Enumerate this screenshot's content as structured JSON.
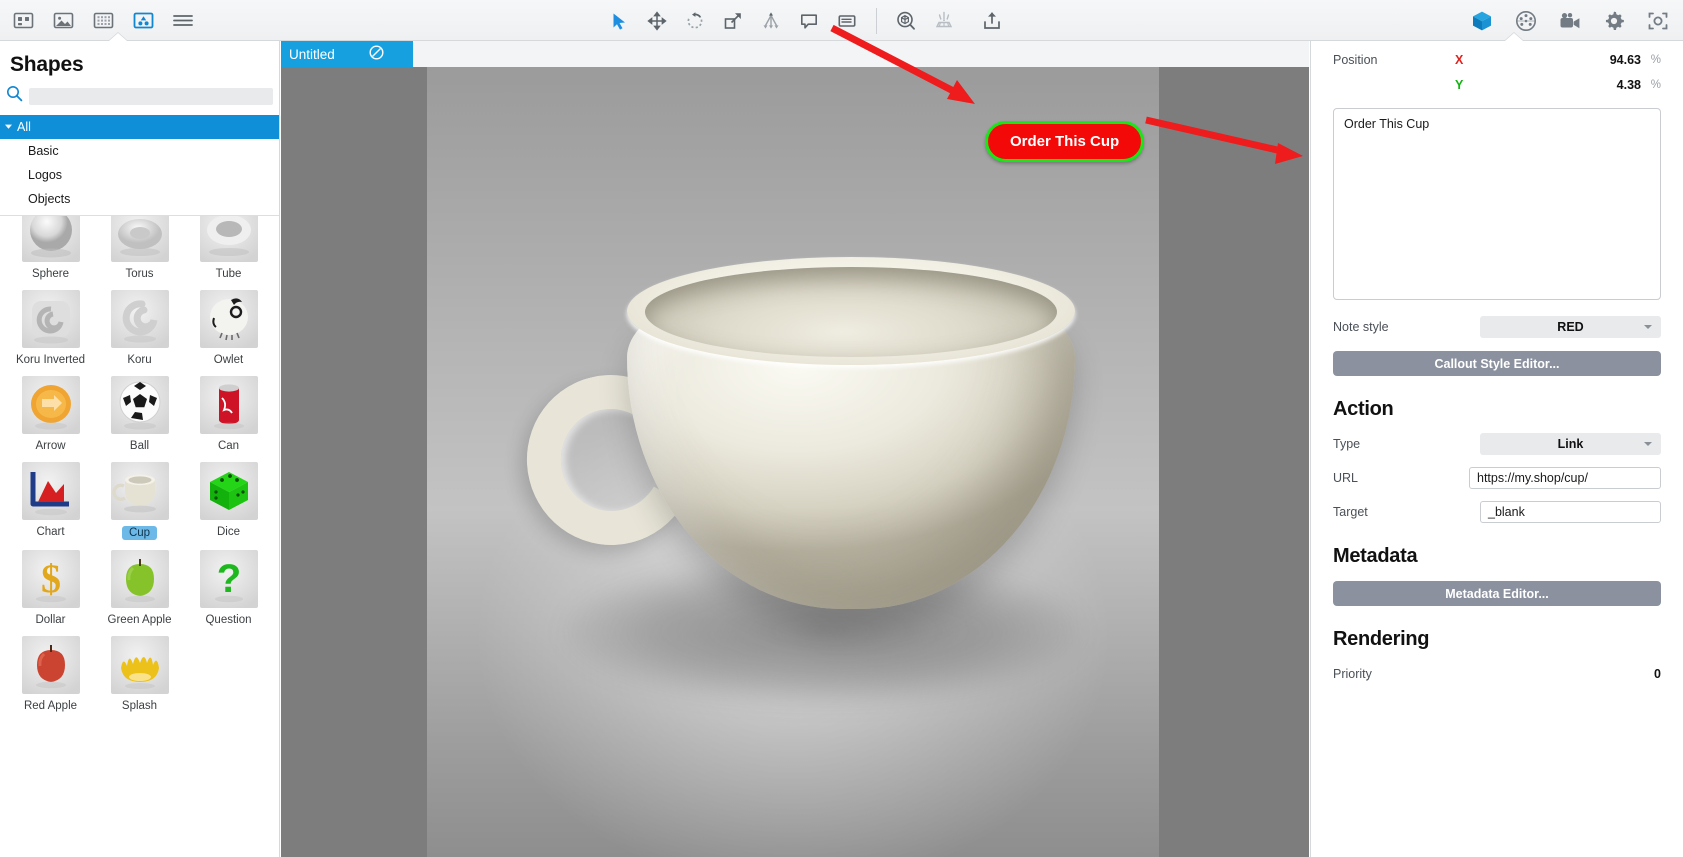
{
  "toolbar": {
    "left_icons": [
      {
        "name": "assets-grid-icon",
        "label": "Assets"
      },
      {
        "name": "image-icon",
        "label": "Images"
      },
      {
        "name": "texture-grid-icon",
        "label": "Textures"
      },
      {
        "name": "shapes-icon",
        "label": "Shapes"
      },
      {
        "name": "hamburger-menu-icon",
        "label": "Menu"
      }
    ],
    "center_icons": [
      {
        "name": "select-arrow-icon",
        "label": "Select"
      },
      {
        "name": "move-icon",
        "label": "Move"
      },
      {
        "name": "rotate-icon",
        "label": "Rotate"
      },
      {
        "name": "scale-icon",
        "label": "Scale"
      },
      {
        "name": "node-tree-icon",
        "label": "Hierarchy"
      },
      {
        "name": "speech-bubble-icon",
        "label": "Annotation"
      },
      {
        "name": "note-callout-icon",
        "label": "Note"
      },
      {
        "name": "preview-3d-icon",
        "label": "Preview"
      },
      {
        "name": "light-rig-icon",
        "label": "Lighting"
      },
      {
        "name": "export-share-icon",
        "label": "Export"
      }
    ],
    "right_icons": [
      {
        "name": "cube-3d-icon",
        "label": "Object"
      },
      {
        "name": "material-sphere-icon",
        "label": "Material"
      },
      {
        "name": "video-camera-icon",
        "label": "Camera"
      },
      {
        "name": "gear-icon",
        "label": "Settings"
      },
      {
        "name": "capture-frame-icon",
        "label": "Capture"
      }
    ]
  },
  "sidebar": {
    "title": "Shapes",
    "search_placeholder": "",
    "search_value": "",
    "categories": [
      {
        "label": "All",
        "selected": true
      },
      {
        "label": "Basic",
        "selected": false
      },
      {
        "label": "Logos",
        "selected": false
      },
      {
        "label": "Objects",
        "selected": false
      }
    ],
    "shapes": [
      {
        "label": "Sphere",
        "selected": false,
        "icon": "sphere-thumb"
      },
      {
        "label": "Torus",
        "selected": false,
        "icon": "torus-thumb"
      },
      {
        "label": "Tube",
        "selected": false,
        "icon": "tube-thumb"
      },
      {
        "label": "Koru Inverted",
        "selected": false,
        "icon": "koru-inverted-thumb"
      },
      {
        "label": "Koru",
        "selected": false,
        "icon": "koru-thumb"
      },
      {
        "label": "Owlet",
        "selected": false,
        "icon": "owlet-thumb"
      },
      {
        "label": "Arrow",
        "selected": false,
        "icon": "arrow-thumb"
      },
      {
        "label": "Ball",
        "selected": false,
        "icon": "ball-thumb"
      },
      {
        "label": "Can",
        "selected": false,
        "icon": "can-thumb"
      },
      {
        "label": "Chart",
        "selected": false,
        "icon": "chart-thumb"
      },
      {
        "label": "Cup",
        "selected": true,
        "icon": "cup-thumb"
      },
      {
        "label": "Dice",
        "selected": false,
        "icon": "dice-thumb"
      },
      {
        "label": "Dollar",
        "selected": false,
        "icon": "dollar-thumb"
      },
      {
        "label": "Green Apple",
        "selected": false,
        "icon": "green-apple-thumb"
      },
      {
        "label": "Question",
        "selected": false,
        "icon": "question-thumb"
      },
      {
        "label": "Red Apple",
        "selected": false,
        "icon": "red-apple-thumb"
      },
      {
        "label": "Splash",
        "selected": false,
        "icon": "splash-thumb"
      }
    ]
  },
  "canvas": {
    "tab_label": "Untitled",
    "tab_icon": "edit-pencil-circle-icon",
    "callout_label": "Order This Cup",
    "callout_fill": "#f40909",
    "callout_border": "#19e619",
    "callout_text_color": "#ffffff",
    "scene_object": "cup-3d-model"
  },
  "inspector": {
    "position": {
      "label": "Position",
      "x_axis": "X",
      "x_value": "94.63",
      "x_unit": "%",
      "y_axis": "Y",
      "y_value": "4.38",
      "y_unit": "%",
      "x_color": "#e0231e",
      "y_color": "#12b312"
    },
    "note_text": "Order This Cup",
    "note_style": {
      "label": "Note style",
      "value": "RED"
    },
    "callout_style_editor_label": "Callout Style Editor...",
    "action": {
      "heading": "Action",
      "type_label": "Type",
      "type_value": "Link",
      "url_label": "URL",
      "url_value": "https://my.shop/cup/",
      "target_label": "Target",
      "target_value": "_blank"
    },
    "metadata": {
      "heading": "Metadata",
      "editor_label": "Metadata Editor..."
    },
    "rendering": {
      "heading": "Rendering",
      "priority_label": "Priority",
      "priority_value": "0"
    }
  },
  "annotations": {
    "arrow_color": "#ee1c1c",
    "arrow_1": "points to callout button on canvas",
    "arrow_2": "points to note text field in inspector"
  }
}
